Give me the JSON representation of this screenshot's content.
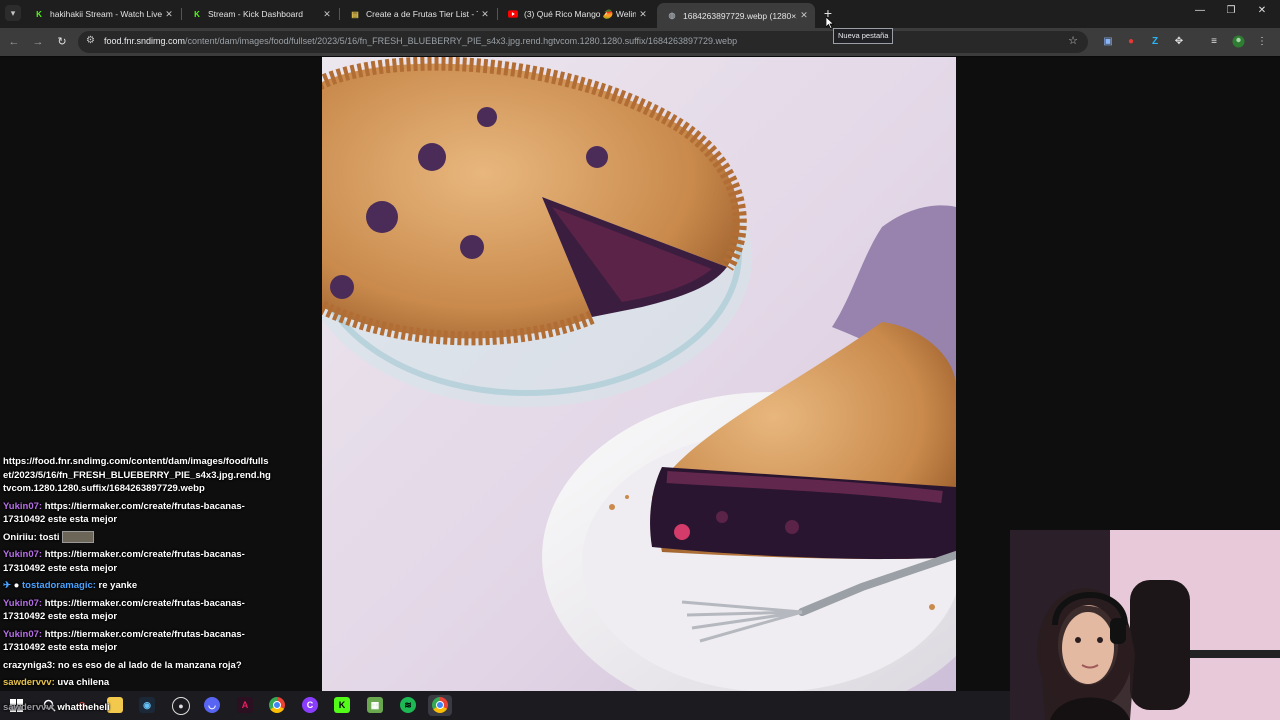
{
  "tabs": [
    {
      "title": "hakihakii Stream - Watch Live o",
      "icon": "kick-icon",
      "color": "#53fc18"
    },
    {
      "title": "Stream - Kick Dashboard",
      "icon": "kick-icon",
      "color": "#53fc18"
    },
    {
      "title": "Create a de Frutas Tier List - Tie",
      "icon": "tiermaker-icon",
      "color": "#e6c34d"
    },
    {
      "title": "(3) Qué Rico Mango 🥭 Welin",
      "icon": "youtube-icon",
      "color": "#ff0000"
    },
    {
      "title": "1684263897729.webp (1280×1",
      "icon": "globe-icon",
      "color": "#9aa0a6"
    }
  ],
  "new_tab_tooltip": "Nueva pestaña",
  "address_bar": {
    "host": "food.fnr.sndimg.com",
    "path": "/content/dam/images/food/fullset/2023/5/16/fn_FRESH_BLUEBERRY_PIE_s4x3.jpg.rend.hgtvcom.1280.1280.suffix/1684263897729.webp"
  },
  "chat": [
    {
      "user": "",
      "color": "#ffffff",
      "text": "https://food.fnr.sndimg.com/content/dam/images/food/fullset/2023/5/16/fn_FRESH_BLUEBERRY_PIE_s4x3.jpg.rend.hgtvcom.1280.1280.suffix/1684263897729.webp"
    },
    {
      "user": "Yukin07:",
      "color": "#b76fe8",
      "text": "https://tiermaker.com/create/frutas-bacanas-17310492 este esta mejor"
    },
    {
      "user": "Oniriiu:",
      "color": "#ffffff",
      "text": "tosti"
    },
    {
      "user": "Yukin07:",
      "color": "#b76fe8",
      "text": "https://tiermaker.com/create/frutas-bacanas-17310492 este esta mejor"
    },
    {
      "user": "tostadoramagic:",
      "color": "#4aa3ff",
      "text": "re yanke"
    },
    {
      "user": "Yukin07:",
      "color": "#b76fe8",
      "text": "https://tiermaker.com/create/frutas-bacanas-17310492 este esta mejor"
    },
    {
      "user": "Yukin07:",
      "color": "#b76fe8",
      "text": "https://tiermaker.com/create/frutas-bacanas-17310492 este esta mejor"
    },
    {
      "user": "crazyniga3:",
      "color": "#ffffff",
      "text": "no es eso de al lado de la manzana roja?"
    },
    {
      "user": "sawdervvv:",
      "color": "#ffffff",
      "text": "uva chilena"
    },
    {
      "user": "sawdervvv:",
      "color": "#ffffff",
      "text": "whattheheli"
    }
  ],
  "taskbar_icons": [
    {
      "name": "windows-start-icon",
      "color": "#ffffff"
    },
    {
      "name": "search-icon",
      "color": "#ffffff"
    },
    {
      "name": "headset-icon",
      "color": "#e74c3c"
    },
    {
      "name": "file-explorer-icon",
      "color": "#f2c94c"
    },
    {
      "name": "steam-icon",
      "color": "#66c0f4"
    },
    {
      "name": "obs-icon",
      "color": "#dddddd"
    },
    {
      "name": "discord-icon",
      "color": "#5865f2"
    },
    {
      "name": "affinity-icon",
      "color": "#c2185b"
    },
    {
      "name": "chrome-icon",
      "color": "#fbbc04"
    },
    {
      "name": "canva-icon",
      "color": "#8b3dff"
    },
    {
      "name": "kick-icon",
      "color": "#53fc18"
    },
    {
      "name": "minecraft-icon",
      "color": "#6aa84f"
    },
    {
      "name": "spotify-icon",
      "color": "#1db954"
    },
    {
      "name": "chrome-active-icon",
      "color": "#fbbc04"
    }
  ]
}
